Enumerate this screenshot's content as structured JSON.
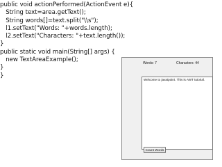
{
  "code": {
    "lines": [
      "public void actionPerformed(ActionEvent e){",
      "   String text=area.getText();",
      "   String words[]=text.split(\"\\\\s\");",
      "   l1.setText(\"Words: \"+words.length);",
      "   l2.setText(\"Characters: \"+text.length());",
      "}",
      "public static void main(String[] args) {",
      "   new TextAreaExample();",
      "}",
      "}"
    ]
  },
  "app_window": {
    "words_label": "Words: 7",
    "characters_label": "Characters: 44",
    "textarea_value": "Welcome to javatpoint. This is AWT tutorial.",
    "count_button_label": "Count Words"
  }
}
